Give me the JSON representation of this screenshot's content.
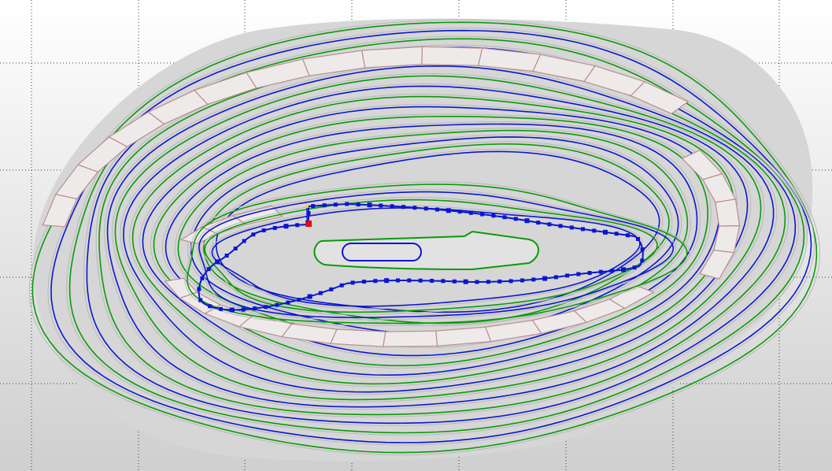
{
  "viewport": {
    "background_top": "#ffffff",
    "background_bottom": "#cfcfcf",
    "grid_color": "#3a3a3a",
    "grid_style": "dotted"
  },
  "toolpath": {
    "outer_offset_passes": 16,
    "pass_colors": [
      "#0a9a0a",
      "#0b15d2"
    ],
    "guide_line_color": "#b8b8b8",
    "stock_region_fill": "#d6d6d6",
    "stock_tile_fill": "#eeeaea",
    "stock_tile_stroke": "#b98e8e",
    "core_path_color": "#0b15d2",
    "core_marker_color": "#0b15d2",
    "start_marker_color": "#e01010",
    "lead_marker_color": "#ffd400",
    "island_outer_color": "#0a9a0a",
    "island_inner_color": "#0b15d2"
  }
}
